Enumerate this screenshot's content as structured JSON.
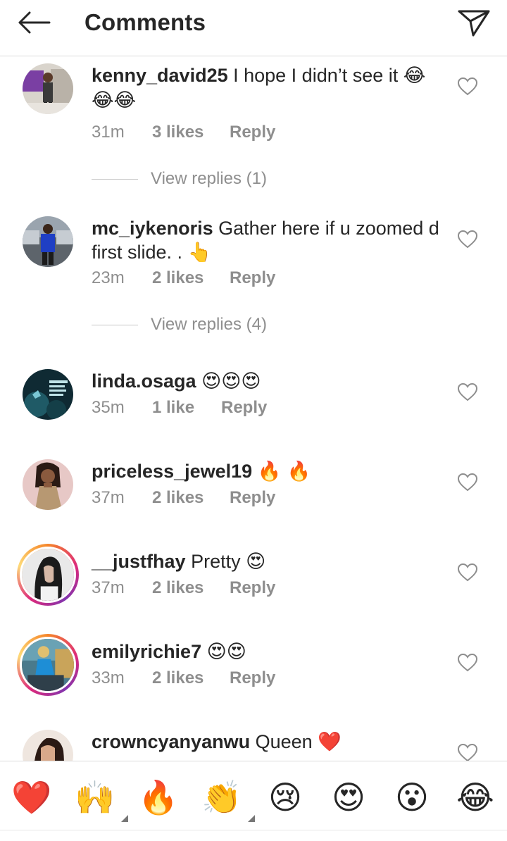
{
  "header": {
    "title": "Comments"
  },
  "comments": [
    {
      "username": "kenny_david25",
      "text": " I hope I didn’t see it ",
      "emoji": "😂",
      "text2": "😂😂",
      "time": "31m",
      "likes": "3 likes",
      "reply": "Reply",
      "replies": "View replies (1)"
    },
    {
      "username": "mc_iykenoris",
      "text": " Gather here if u zoomed d first slide. . ",
      "emoji": "👆",
      "time": "23m",
      "likes": "2 likes",
      "reply": "Reply",
      "replies": "View replies (4)"
    },
    {
      "username": "linda.osaga",
      "text": " ",
      "emoji": "😍😍😍",
      "time": "35m",
      "likes": "1 like",
      "reply": "Reply"
    },
    {
      "username": "priceless_jewel19",
      "text": " ",
      "emoji": "🔥 🔥",
      "time": "37m",
      "likes": "2 likes",
      "reply": "Reply"
    },
    {
      "username": "__justfhay",
      "text": " Pretty ",
      "emoji": "😍",
      "time": "37m",
      "likes": "2 likes",
      "reply": "Reply"
    },
    {
      "username": "emilyrichie7",
      "text": " ",
      "emoji": "😍😍",
      "time": "33m",
      "likes": "2 likes",
      "reply": "Reply"
    },
    {
      "username": "crowncyanyanwu",
      "text": " Queen ",
      "emoji": "❤️"
    }
  ],
  "reactions": [
    "❤️",
    "🙌",
    "🔥",
    "👏",
    "😢",
    "😍",
    "😮",
    "😂"
  ],
  "colors": {
    "text": "#262626",
    "meta": "#8e8e8e",
    "divider": "#dbdbdb",
    "heart_red": "#ed4956"
  },
  "icons": {
    "back": "back-arrow-icon",
    "share": "send-icon",
    "like": "heart-outline-icon"
  }
}
